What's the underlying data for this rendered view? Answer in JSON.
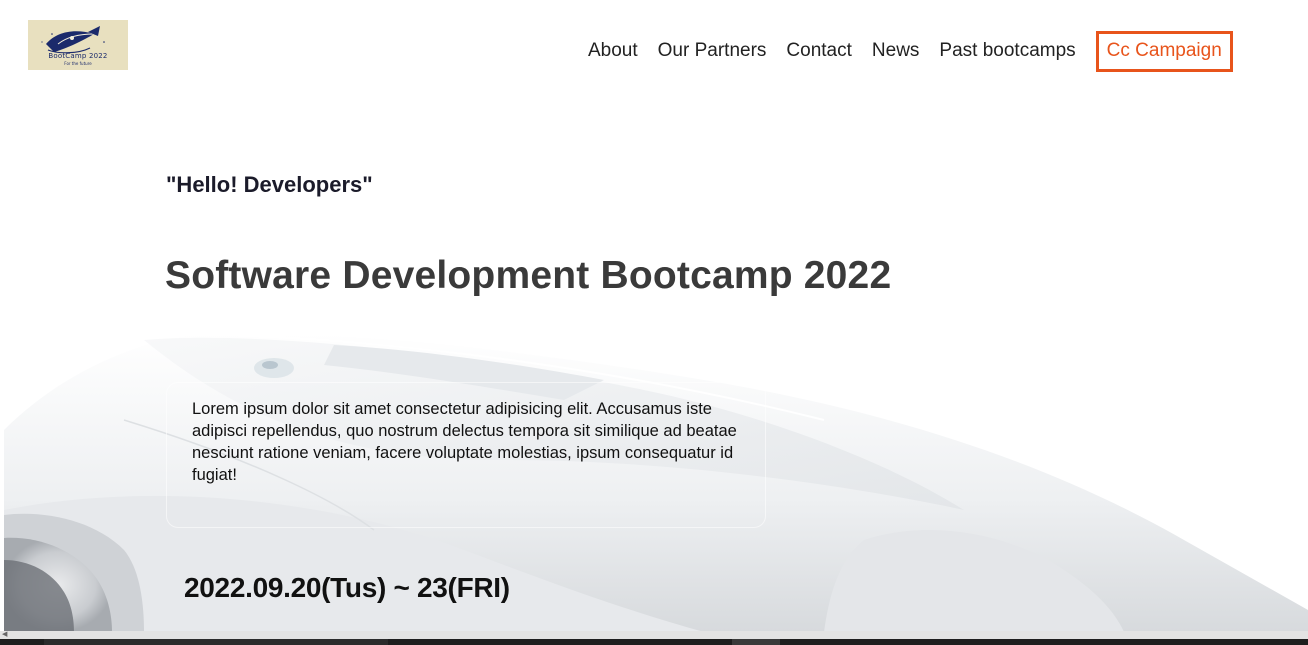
{
  "header": {
    "logo": {
      "wordmark": "BootCamp 2022",
      "tagline": "For the future"
    },
    "nav": {
      "items": [
        {
          "label": "About"
        },
        {
          "label": "Our Partners"
        },
        {
          "label": "Contact"
        },
        {
          "label": "News"
        },
        {
          "label": "Past bootcamps"
        },
        {
          "label": "Cc Campaign"
        }
      ]
    }
  },
  "hero": {
    "greeting": "\"Hello! Developers\"",
    "title": "Software Development Bootcamp 2022",
    "description": "Lorem ipsum dolor sit amet consectetur adipisicing elit. Accusamus iste adipisci repellendus, quo nostrum delectus tempora sit similique ad beatae nesciunt ratione veniam, facere voluptate molestias, ipsum consequatur id fugiat!",
    "date": "2022.09.20(Tus) ~ 23(FRI)"
  },
  "colors": {
    "accent": "#e8541b",
    "title_gray": "#3a3a3a",
    "logo_bg": "#e8e0bf",
    "logo_ink": "#1b2a6b"
  },
  "icons": {
    "logo_mark": "rocket-logo-icon",
    "scroll_left": "scroll-left-arrow-icon"
  }
}
